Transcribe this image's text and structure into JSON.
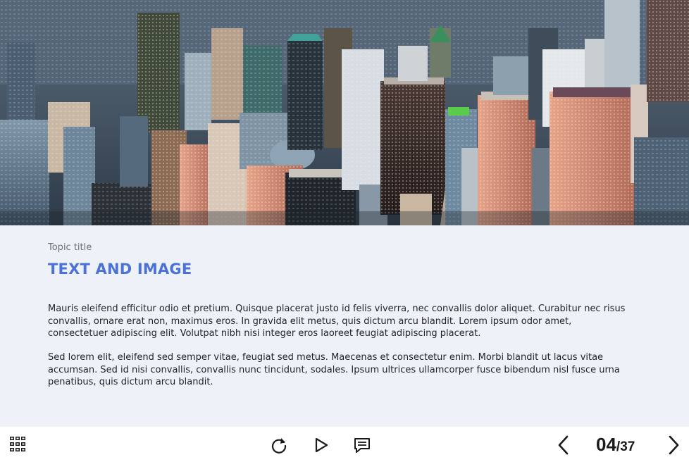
{
  "slide": {
    "topic_label": "Topic title",
    "heading": "TEXT AND IMAGE",
    "paragraphs": [
      "Mauris eleifend efficitur odio et pretium. Quisque placerat justo id felis viverra, nec convallis dolor aliquet. Curabitur nec risus convallis, ornare erat non, maximus eros. In gravida elit metus, quis dictum arcu blandit. Lorem ipsum odor amet, consectetuer adipiscing elit. Volutpat nibh nisi integer eros laoreet feugiat adipiscing placerat.",
      "Sed lorem elit, eleifend sed semper vitae, feugiat sed metus. Maecenas et consectetur enim. Morbi blandit ut lacus vitae accumsan. Sed id nisi convallis, convallis nunc tincidunt, sodales. Ipsum ultrices ullamcorper fusce bibendum nisl fusce urna penatibus, quis dictum arcu blandit."
    ]
  },
  "toolbar": {
    "menu_icon": "grid-menu-icon",
    "replay_icon": "replay-icon",
    "play_icon": "play-icon",
    "notes_icon": "notes-icon",
    "prev_icon": "chevron-left-icon",
    "next_icon": "chevron-right-icon"
  },
  "pagination": {
    "current": "04",
    "separator": "/",
    "total": "37"
  },
  "colors": {
    "heading": "#4a72d9",
    "background": "#eef1f7",
    "footer": "#ffffff"
  }
}
